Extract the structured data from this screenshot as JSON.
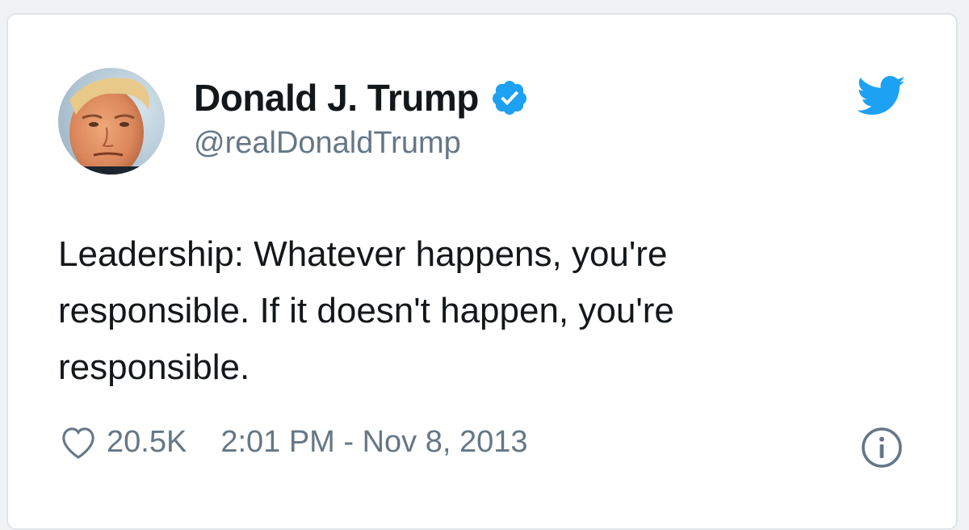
{
  "tweet": {
    "author_name": "Donald J. Trump",
    "author_handle": "@realDonaldTrump",
    "text": "Leadership: Whatever happens, you're\nresponsible. If it doesn't happen, you're\nresponsible.",
    "likes": "20.5K",
    "timestamp": "2:01 PM - Nov 8, 2013",
    "verified": true
  },
  "icons": {
    "verified": "verified-badge-icon",
    "brand": "twitter-bird-icon",
    "like": "heart-icon",
    "info": "info-icon"
  },
  "colors": {
    "brand_blue": "#1da1f2",
    "text_primary": "#14171a",
    "text_secondary": "#657786"
  }
}
